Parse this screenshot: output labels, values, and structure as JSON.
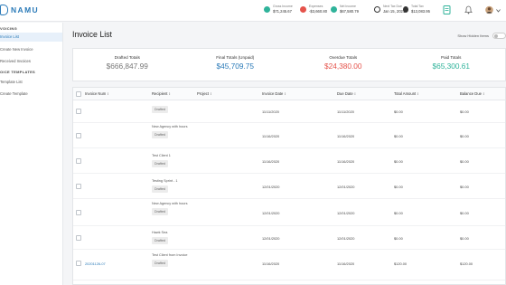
{
  "app": {
    "logo_text": "NAMU"
  },
  "topbar_stats": [
    {
      "label": "Gross Income",
      "value": "$71,245.67",
      "color": "#2fb39a"
    },
    {
      "label": "Expenses",
      "value": "-$3,660.80",
      "color": "#e5534b"
    },
    {
      "label": "Net Income",
      "value": "$67,580.79",
      "color": "#2fb39a"
    },
    {
      "label": "Next Tax Due",
      "value": "Jan 15, 2021",
      "color": "#333333"
    },
    {
      "label": "Total Tax",
      "value": "$13,083.95",
      "color": "#333333"
    }
  ],
  "sidebar": {
    "sections": [
      {
        "header": "VOICING",
        "items": [
          {
            "label": "Invoice List",
            "active": true
          },
          {
            "label": "Create New Invoice"
          },
          {
            "label": "Received Invoices"
          }
        ]
      },
      {
        "header": "OICE TEMPLATES",
        "items": [
          {
            "label": "Template List"
          },
          {
            "label": "Create Template"
          }
        ]
      }
    ]
  },
  "page": {
    "title": "Invoice List",
    "show_hidden_label": "Show Hidden Items"
  },
  "totals": [
    {
      "label": "Drafted Totals",
      "value": "$666,847.99",
      "color": "#777777"
    },
    {
      "label": "Final Totals (Unpaid)",
      "value": "$45,709.75",
      "color": "#2a7ab8"
    },
    {
      "label": "Overdue Totals",
      "value": "$24,380.00",
      "color": "#e5534b"
    },
    {
      "label": "Paid Totals",
      "value": "$65,300.61",
      "color": "#2fb39a"
    }
  ],
  "table": {
    "columns": [
      "Invoice Num ↕",
      "Recipient ↕",
      "Project ↕",
      "Invoice Date ↕",
      "Due Date ↕",
      "Total Amount ↕",
      "Balance Due ↕"
    ],
    "rows": [
      {
        "invoice_num": "",
        "recipient": "",
        "status": "Drafted",
        "invoice_date": "11/11/2020",
        "due_date": "11/11/2020",
        "total": "$0.00",
        "balance": "$0.00"
      },
      {
        "invoice_num": "",
        "recipient": "New Agency with hours",
        "status": "Drafted",
        "invoice_date": "11/16/2020",
        "due_date": "11/16/2020",
        "total": "$0.00",
        "balance": "$0.00"
      },
      {
        "invoice_num": "",
        "recipient": "Test Client 1",
        "status": "Drafted",
        "invoice_date": "11/16/2020",
        "due_date": "11/16/2020",
        "total": "$0.00",
        "balance": "$0.00"
      },
      {
        "invoice_num": "",
        "recipient": "Testing Sprint - 1",
        "status": "Drafted",
        "invoice_date": "12/01/2020",
        "due_date": "12/01/2020",
        "total": "$0.00",
        "balance": "$0.00"
      },
      {
        "invoice_num": "",
        "recipient": "New Agency with hours",
        "status": "Drafted",
        "invoice_date": "12/01/2020",
        "due_date": "12/01/2020",
        "total": "$0.00",
        "balance": "$0.00"
      },
      {
        "invoice_num": "",
        "recipient": "Hawk Sea",
        "status": "Drafted",
        "invoice_date": "12/01/2020",
        "due_date": "12/01/2020",
        "total": "$0.00",
        "balance": "$0.00"
      },
      {
        "invoice_num": "20201126-07",
        "recipient": "Test Client from Invoice",
        "status": "Drafted",
        "invoice_date": "11/16/2020",
        "due_date": "11/16/2020",
        "total": "$120.00",
        "balance": "$120.00"
      }
    ]
  }
}
